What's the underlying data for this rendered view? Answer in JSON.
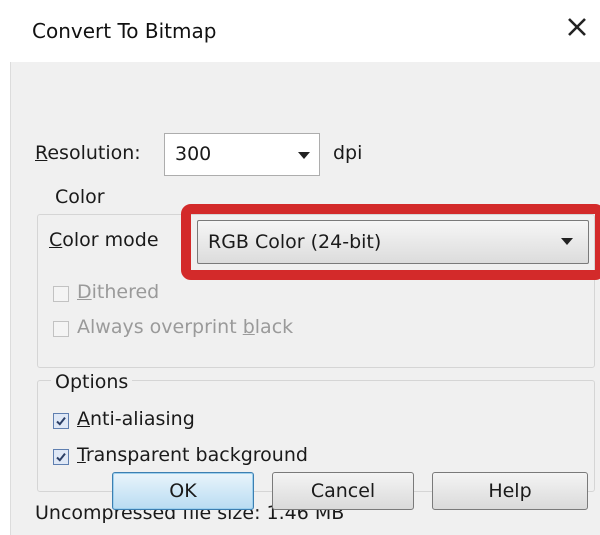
{
  "window": {
    "title": "Convert To Bitmap",
    "close_icon": "close-icon"
  },
  "resolution": {
    "label_u": "R",
    "label_rest": "esolution:",
    "value": "300",
    "unit": "dpi"
  },
  "color_group": {
    "title": "Color",
    "mode_label_u": "C",
    "mode_label_rest": "olor mode",
    "mode_value": "RGB Color (24-bit)",
    "dithered": {
      "u": "D",
      "rest": "ithered",
      "checked": false,
      "enabled": false
    },
    "overprint": {
      "pre": "Always overprint ",
      "u": "b",
      "rest": "lack",
      "checked": false,
      "enabled": false
    }
  },
  "options_group": {
    "title": "Options",
    "anti_aliasing": {
      "u": "A",
      "rest": "nti-aliasing",
      "checked": true
    },
    "transparent_bg": {
      "u": "T",
      "rest": "ransparent background",
      "checked": true
    }
  },
  "file_size": {
    "text": "Uncompressed file size: 1.46 MB"
  },
  "buttons": {
    "ok": "OK",
    "cancel": "Cancel",
    "help": "Help"
  },
  "colors": {
    "highlight": "#d32a2a",
    "default_button": "#3c7fb1"
  }
}
